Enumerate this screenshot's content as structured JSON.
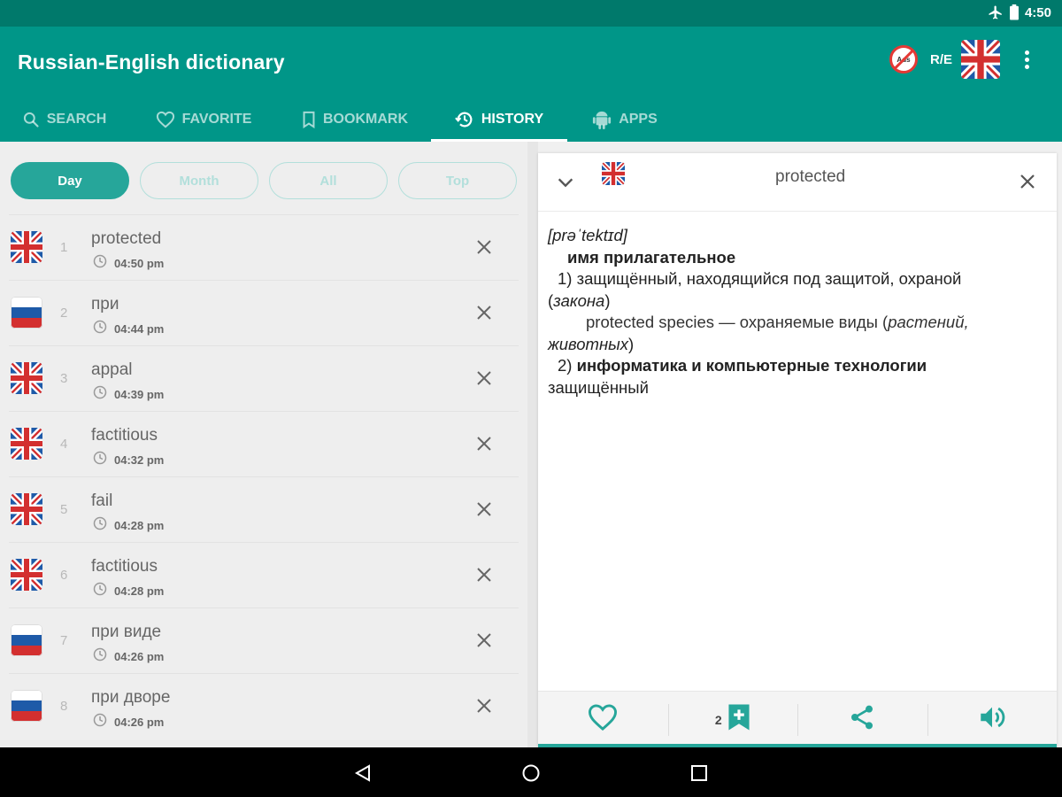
{
  "status_bar": {
    "time": "4:50",
    "icons": [
      "airplane-icon",
      "battery-icon"
    ]
  },
  "app": {
    "title": "Russian-English dictionary",
    "direction_label": "R/E",
    "noads_text": "Ads",
    "colors": {
      "primary": "#009688",
      "primary_dark": "#00796b",
      "accent": "#26a69a"
    }
  },
  "tabs": [
    {
      "label": "SEARCH",
      "icon": "search-icon",
      "active": false
    },
    {
      "label": "FAVORITE",
      "icon": "heart-icon",
      "active": false
    },
    {
      "label": "BOOKMARK",
      "icon": "bookmark-icon",
      "active": false
    },
    {
      "label": "HISTORY",
      "icon": "history-icon",
      "active": true
    },
    {
      "label": "APPS",
      "icon": "android-icon",
      "active": false
    }
  ],
  "filters": [
    {
      "label": "Day",
      "active": true
    },
    {
      "label": "Month",
      "active": false
    },
    {
      "label": "All",
      "active": false
    },
    {
      "label": "Top",
      "active": false
    }
  ],
  "history": [
    {
      "index": "1",
      "word": "protected",
      "time": "04:50 pm",
      "lang": "en"
    },
    {
      "index": "2",
      "word": "при",
      "time": "04:44 pm",
      "lang": "ru"
    },
    {
      "index": "3",
      "word": "appal",
      "time": "04:39 pm",
      "lang": "en"
    },
    {
      "index": "4",
      "word": "factitious",
      "time": "04:32 pm",
      "lang": "en"
    },
    {
      "index": "5",
      "word": "fail",
      "time": "04:28 pm",
      "lang": "en"
    },
    {
      "index": "6",
      "word": "factitious",
      "time": "04:28 pm",
      "lang": "en"
    },
    {
      "index": "7",
      "word": "при виде",
      "time": "04:26 pm",
      "lang": "ru"
    },
    {
      "index": "8",
      "word": "при дворе",
      "time": "04:26 pm",
      "lang": "ru"
    }
  ],
  "detail": {
    "word": "protected",
    "transcription": "[prəˈtektɪd]",
    "part_of_speech": "имя прилагательное",
    "sense1_num": "1)",
    "sense1_text": "защищённый, находящийся под защитой, охраной",
    "sense1_paren_open": "(",
    "sense1_paren_italic": "закона",
    "sense1_paren_close": ")",
    "example_text": "protected species — охраняемые виды (",
    "example_italic1": "растений,",
    "example_italic2": "животных",
    "example_close": ")",
    "sense2_num": "2)",
    "sense2_domain": "информатика и компьютерные технологии",
    "sense2_text": "защищённый"
  },
  "actions": {
    "bookmark_count": "2"
  }
}
